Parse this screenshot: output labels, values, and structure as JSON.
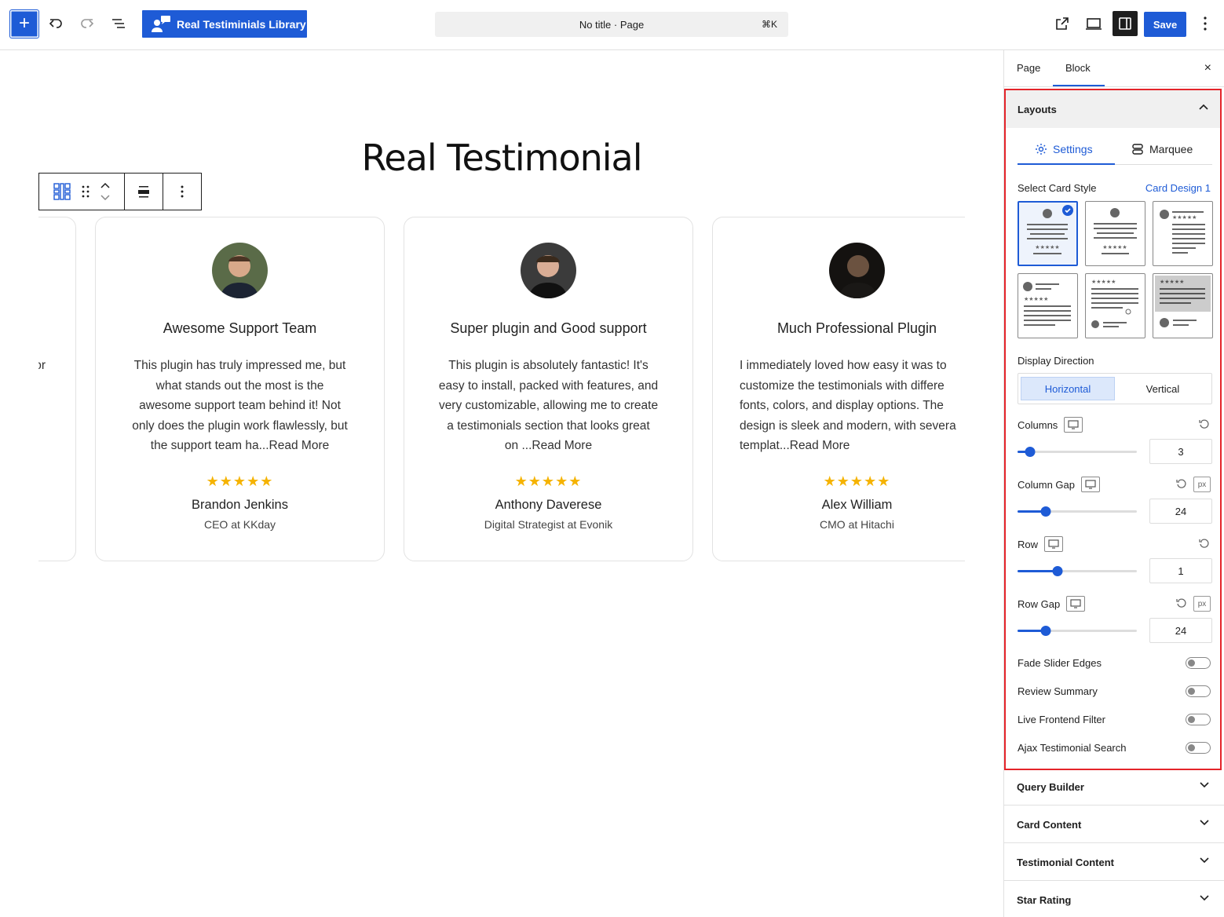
{
  "toolbar": {
    "add_label": "+",
    "library_button": "Real Testiminials Library",
    "search_text": "No title · Page",
    "search_shortcut": "⌘K",
    "save_label": "Save"
  },
  "canvas": {
    "heading": "Real Testimonial",
    "partial_left_text": "or",
    "cards": [
      {
        "title": "Awesome Support Team",
        "text": "This plugin has truly impressed me, but\nwhat stands out the most is the\nawesome support team behind it! Not\nonly does the plugin work flawlessly, but\nthe support team ha...Read More",
        "stars": "★★★★★",
        "name": "Brandon Jenkins",
        "role": "CEO at KKday"
      },
      {
        "title": "Super plugin and Good support",
        "text": "This plugin is absolutely fantastic! It's\neasy to install, packed with features, and\nvery customizable, allowing me to create\na testimonials section that looks great\non ...Read More",
        "stars": "★★★★★",
        "name": "Anthony Daverese",
        "role": "Digital Strategist at Evonik"
      },
      {
        "title": "Much Professional Plugin",
        "text": "I immediately loved how easy it was to\ncustomize the testimonials with differe\nfonts, colors, and display options. The\ndesign is sleek and modern, with severa\ntemplat...Read More",
        "stars": "★★★★★",
        "name": "Alex William",
        "role": "CMO at Hitachi"
      }
    ]
  },
  "sidebar": {
    "tabs": [
      "Page",
      "Block"
    ],
    "close_label": "×",
    "layouts": {
      "title": "Layouts",
      "subtabs": [
        "Settings",
        "Marquee"
      ],
      "card_style_label": "Select Card Style",
      "card_style_value": "Card Design 1",
      "display_direction_label": "Display Direction",
      "directions": [
        "Horizontal",
        "Vertical"
      ],
      "columns_label": "Columns",
      "columns_value": "3",
      "column_gap_label": "Column Gap",
      "column_gap_value": "24",
      "row_label": "Row",
      "row_value": "1",
      "row_gap_label": "Row Gap",
      "row_gap_value": "24",
      "unit": "px",
      "toggles": [
        "Fade Slider Edges",
        "Review Summary",
        "Live Frontend Filter",
        "Ajax Testimonial Search"
      ]
    },
    "panels": [
      "Query Builder",
      "Card Content",
      "Testimonial Content",
      "Star Rating"
    ]
  },
  "colors": {
    "accent": "#1e5bd6",
    "highlight_border": "#e4242a",
    "star": "#f5b301"
  }
}
